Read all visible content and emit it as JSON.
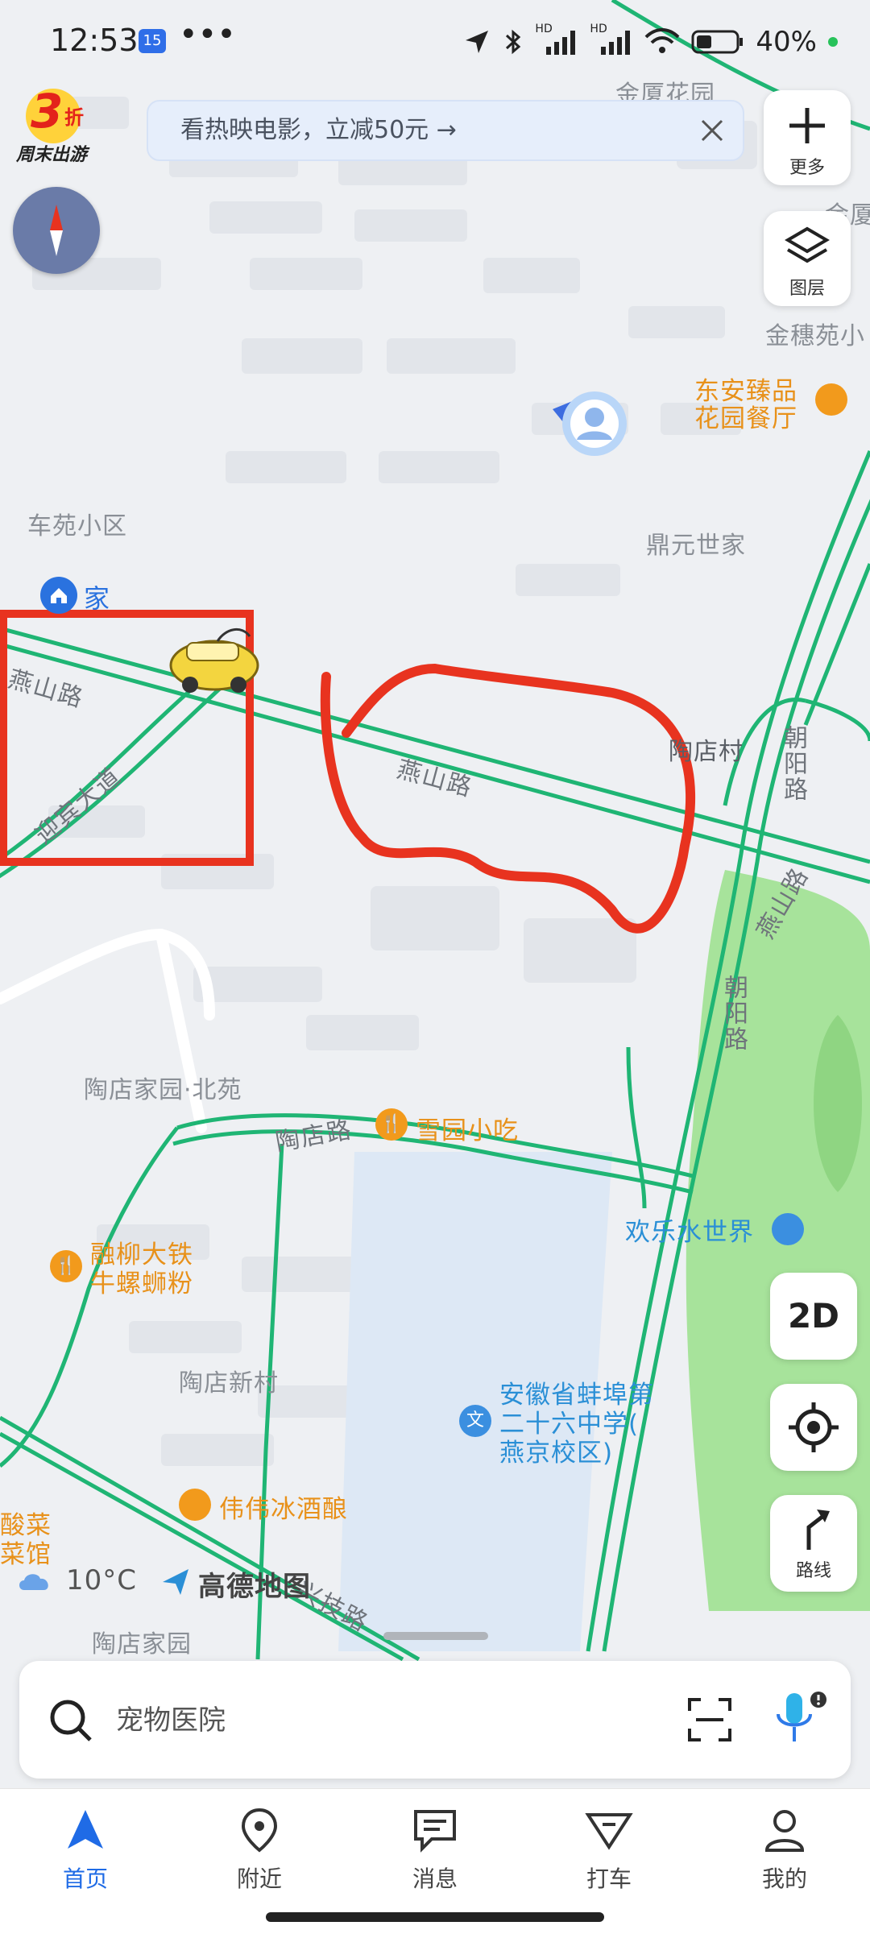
{
  "status_bar": {
    "time": "12:53",
    "notification_badge": "15",
    "more_dots": "•••",
    "battery_text": "40%",
    "hd1": "HD",
    "hd2": "HD"
  },
  "promo": {
    "logo_big": "3",
    "logo_small": "折",
    "logo_caption": "周末出游",
    "banner_text": "看热映电影，立减50元 →"
  },
  "side_buttons": {
    "more_label": "更多",
    "layers_label": "图层",
    "view_mode": "2D",
    "route_label": "路线"
  },
  "map_labels": {
    "area_1": "金厦花园",
    "area_2": "金穗苑小",
    "area_3": "车苑小区",
    "area_4": "鼎元世家",
    "area_5": "陶店村",
    "area_6": "陶店家园·北苑",
    "area_7": "陶店新村",
    "area_8": "陶店家园",
    "area_9": "金厦",
    "home_label": "家",
    "road_1": "燕山路",
    "road_2": "燕山路",
    "road_3": "迎宾大道",
    "road_4": "朝阳路",
    "road_5": "朝阳路",
    "road_6": "燕山路",
    "road_7": "陶店路",
    "road_8": "兴技路",
    "poi_1": "东安臻品",
    "poi_1b": "花园餐厅",
    "poi_2": "雪园小吃",
    "poi_3": "融柳大铁",
    "poi_3b": "牛螺蛳粉",
    "poi_4": "欢乐水世界",
    "poi_5": "安徽省蚌埠第",
    "poi_5b": "二十六中学(",
    "poi_5c": "燕京校区)",
    "poi_6": "伟伟冰酒酿",
    "poi_7": "酸菜",
    "poi_7b": "菜馆",
    "weather": "10°C",
    "brand": "高德地图"
  },
  "search": {
    "placeholder": "宠物医院"
  },
  "tabs": [
    {
      "label": "首页"
    },
    {
      "label": "附近"
    },
    {
      "label": "消息"
    },
    {
      "label": "打车"
    },
    {
      "label": "我的"
    }
  ],
  "colors": {
    "accent": "#1f6be6",
    "road_green": "#1fb574",
    "annotation_red": "#e8331f",
    "park_green": "#a7e39b"
  }
}
